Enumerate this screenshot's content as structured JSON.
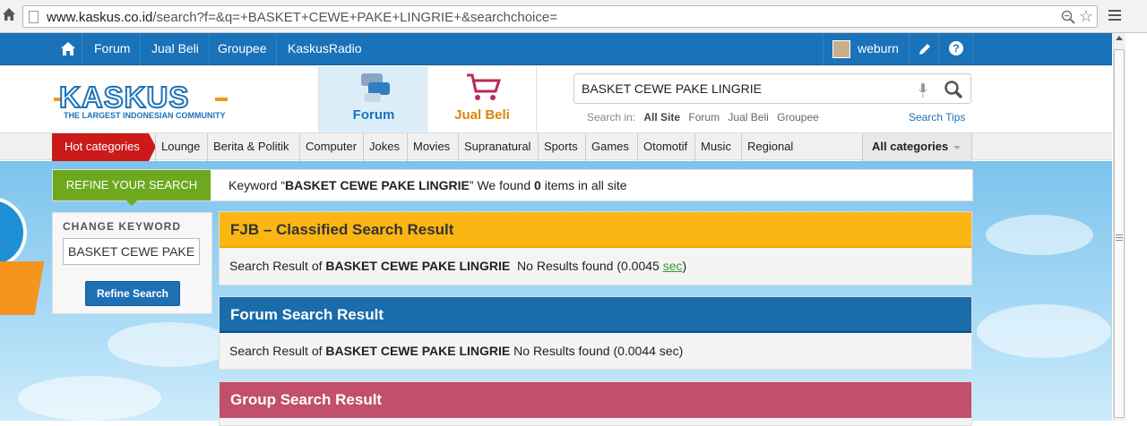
{
  "browser": {
    "url_host": "www.kaskus.co.id",
    "url_path": "/search?f=&q=+BASKET+CEWE+PAKE+LINGRIE+&searchchoice="
  },
  "topnav": {
    "items": [
      "Forum",
      "Jual Beli",
      "Groupee",
      "KaskusRadio"
    ],
    "username": "weburn"
  },
  "header": {
    "logo_text": "KASKUS",
    "logo_tagline": "THE LARGEST INDONESIAN COMMUNITY",
    "tabs": [
      {
        "label": "Forum"
      },
      {
        "label": "Jual Beli"
      }
    ],
    "search": {
      "value": "BASKET CEWE PAKE LINGRIE",
      "search_in_label": "Search in:",
      "options": [
        "All Site",
        "Forum",
        "Jual Beli",
        "Groupee"
      ],
      "active_option": "All Site",
      "tips": "Search Tips"
    }
  },
  "categories": {
    "hot": "Hot categories",
    "items": [
      "Lounge",
      "Berita & Politik",
      "Computer",
      "Jokes",
      "Movies",
      "Supranatural",
      "Sports",
      "Games",
      "Otomotif",
      "Music",
      "Regional"
    ],
    "all": "All categories"
  },
  "refine": {
    "button": "REFINE YOUR SEARCH",
    "msg_prefix": "Keyword “",
    "keyword": "BASKET CEWE PAKE LINGRIE",
    "msg_mid": "” We found ",
    "count": "0",
    "msg_suffix": " items in all site"
  },
  "change_keyword": {
    "title": "CHANGE KEYWORD",
    "value": "BASKET CEWE PAKE LINGRIE",
    "button": "Refine Search"
  },
  "results": {
    "fjb": {
      "title": "FJB – Classified Search Result",
      "prefix": "Search Result of ",
      "keyword": "BASKET CEWE PAKE LINGRIE",
      "text": "  No Results found (0.0045 ",
      "sec": "sec",
      "close": ")"
    },
    "forum": {
      "title": "Forum Search Result",
      "prefix": "Search Result of ",
      "keyword": "BASKET CEWE PAKE LINGRIE",
      "text": " No Results found (0.0044 sec)"
    },
    "group": {
      "title": "Group Search Result"
    }
  },
  "colors": {
    "nav_blue": "#1a72b9",
    "hot_red": "#cc1a1a",
    "refine_green": "#6ea81f",
    "fjb_yellow": "#fbb613",
    "forum_blue": "#1a6cab",
    "group_pink": "#c24f6b"
  }
}
